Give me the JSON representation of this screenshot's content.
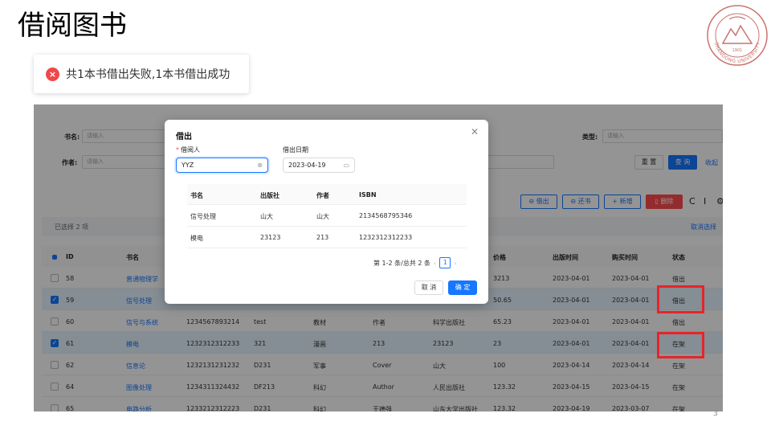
{
  "slide": {
    "title": "借阅图书",
    "page_number": "3"
  },
  "logo": {
    "text": "SHANDONG UNIVERSITY",
    "year": "1901"
  },
  "toast": {
    "icon": "error-icon",
    "message": "共1本书借出失败,1本书借出成功"
  },
  "search": {
    "name_label": "书名:",
    "name_placeholder": "请输入",
    "author_label": "作者:",
    "author_placeholder": "请输入",
    "type_label": "类型:",
    "type_placeholder": "请输入",
    "reset": "重 置",
    "query": "查 询",
    "collapse": "收起"
  },
  "toolbar": {
    "lend": "借出",
    "return": "还书",
    "add": "新增",
    "delete": "删除"
  },
  "selection": {
    "text": "已选择 2 项",
    "clear": "取消选择"
  },
  "table": {
    "headers": [
      "ID",
      "书名",
      "价格",
      "出版时间",
      "购买时间",
      "状态"
    ],
    "rows": [
      {
        "id": "58",
        "name": "普通物理学",
        "isbn": "",
        "publisher": "",
        "type": "",
        "author": "",
        "press": "",
        "price": "3213",
        "pub_date": "2023-04-01",
        "buy_date": "2023-04-01",
        "status": "借出",
        "selected": false
      },
      {
        "id": "59",
        "name": "信号处理",
        "isbn": "",
        "publisher": "",
        "type": "",
        "author": "",
        "press": "",
        "price": "50.65",
        "pub_date": "2023-04-01",
        "buy_date": "2023-04-01",
        "status": "借出",
        "selected": true
      },
      {
        "id": "60",
        "name": "信号与系统",
        "isbn": "1234567893214",
        "publisher": "test",
        "type": "教材",
        "author": "作者",
        "press": "科学出版社",
        "price": "65.23",
        "pub_date": "2023-04-01",
        "buy_date": "2023-04-01",
        "status": "借出",
        "selected": false
      },
      {
        "id": "61",
        "name": "模电",
        "isbn": "1232312312233",
        "publisher": "321",
        "type": "漫画",
        "author": "213",
        "press": "23123",
        "price": "23",
        "pub_date": "2023-04-01",
        "buy_date": "2023-04-01",
        "status": "在架",
        "selected": true
      },
      {
        "id": "62",
        "name": "信息论",
        "isbn": "1232131231232",
        "publisher": "D231",
        "type": "军事",
        "author": "Cover",
        "press": "山大",
        "price": "100",
        "pub_date": "2023-04-14",
        "buy_date": "2023-04-14",
        "status": "在架",
        "selected": false
      },
      {
        "id": "64",
        "name": "图像处理",
        "isbn": "1234311324432",
        "publisher": "DF213",
        "type": "科幻",
        "author": "Author",
        "press": "人民出版社",
        "price": "123.32",
        "pub_date": "2023-04-15",
        "buy_date": "2023-04-15",
        "status": "在架",
        "selected": false
      },
      {
        "id": "65",
        "name": "电路分析",
        "isbn": "1233212312223",
        "publisher": "D231",
        "type": "科幻",
        "author": "王德强",
        "press": "山东大学出版社",
        "price": "123.32",
        "pub_date": "2023-04-19",
        "buy_date": "2023-03-07",
        "status": "在架",
        "selected": false
      }
    ]
  },
  "modal": {
    "title": "借出",
    "borrower_label": "借阅人",
    "borrower_value": "YYZ",
    "date_label": "借出日期",
    "date_value": "2023-04-19",
    "table_headers": [
      "书名",
      "出版社",
      "作者",
      "ISBN"
    ],
    "table_rows": [
      [
        "信号处理",
        "山大",
        "山大",
        "2134568795346"
      ],
      [
        "模电",
        "23123",
        "213",
        "1232312312233"
      ]
    ],
    "pager_text": "第 1-2 条/总共 2 条",
    "current_page": "1",
    "cancel": "取 消",
    "ok": "确 定"
  }
}
